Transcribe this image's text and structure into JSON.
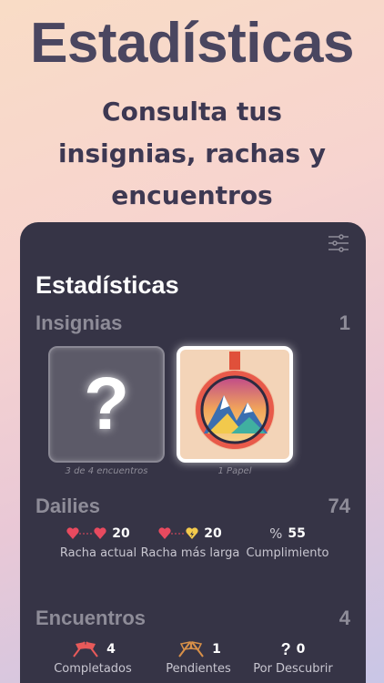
{
  "promo": {
    "title": "Estadísticas",
    "subtitle": "Consulta tus insignias, rachas y encuentros"
  },
  "screen": {
    "title": "Estadísticas",
    "insignias": {
      "label": "Insignias",
      "count": "1",
      "badges": [
        {
          "caption": "3 de 4 encuentros",
          "locked": true,
          "icon": "question-mark"
        },
        {
          "caption": "1 Papel",
          "locked": false,
          "icon": "mountain-medal"
        }
      ]
    },
    "dailies": {
      "label": "Dailies",
      "count": "74",
      "stats": [
        {
          "value": "20",
          "label": "Racha actual",
          "icon": "hearts-icon"
        },
        {
          "value": "20",
          "label": "Racha más larga",
          "icon": "heart-bolt-icon"
        },
        {
          "value": "55",
          "label": "Cumplimiento",
          "icon": "percent-icon"
        }
      ]
    },
    "encuentros": {
      "label": "Encuentros",
      "count": "4",
      "stats": [
        {
          "value": "4",
          "label": "Completados",
          "icon": "red-flags-icon"
        },
        {
          "value": "1",
          "label": "Pendientes",
          "icon": "orange-flags-icon"
        },
        {
          "value": "0",
          "label": "Por Descubrir",
          "icon": "question-icon"
        }
      ]
    }
  },
  "colors": {
    "panel": "#363446",
    "heart": "#e84a5f",
    "bolt_heart": "#f2c94c",
    "flag_red": "#e85a5a",
    "flag_orange": "#d89048"
  }
}
